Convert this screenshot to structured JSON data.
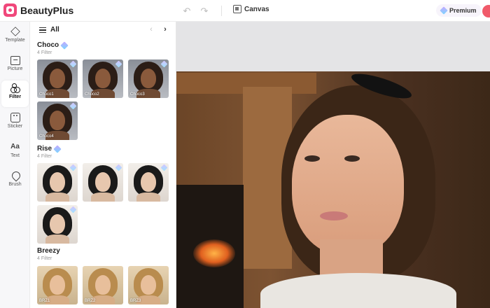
{
  "app": {
    "name": "BeautyPlus",
    "canvas_label": "Canvas",
    "premium_label": "Premium",
    "colors": {
      "accent": "#f0477b",
      "avatar": "#f05a6a"
    }
  },
  "rail": {
    "items": [
      {
        "label": "Template",
        "icon": "layers-icon",
        "active": false
      },
      {
        "label": "Picture",
        "icon": "picture-icon",
        "active": false
      },
      {
        "label": "Filter",
        "icon": "filter-icon",
        "active": true
      },
      {
        "label": "Sticker",
        "icon": "sticker-icon",
        "active": false
      },
      {
        "label": "Text",
        "icon": "text-icon",
        "active": false,
        "glyph": "Aa"
      },
      {
        "label": "Brush",
        "icon": "brush-icon",
        "active": false
      }
    ]
  },
  "panel": {
    "title": "All",
    "groups": [
      {
        "name": "Choco",
        "count": "4 Filter",
        "thumbs": [
          "Choco1",
          "Choco2",
          "Choco3",
          "Choco4"
        ]
      },
      {
        "name": "Rise",
        "count": "4 Filter",
        "thumbs": [
          "",
          "",
          "",
          ""
        ]
      },
      {
        "name": "Breezy",
        "count": "4 Filter",
        "thumbs": [
          "BRZ1",
          "BRZ2",
          "BRZ3"
        ]
      }
    ]
  }
}
